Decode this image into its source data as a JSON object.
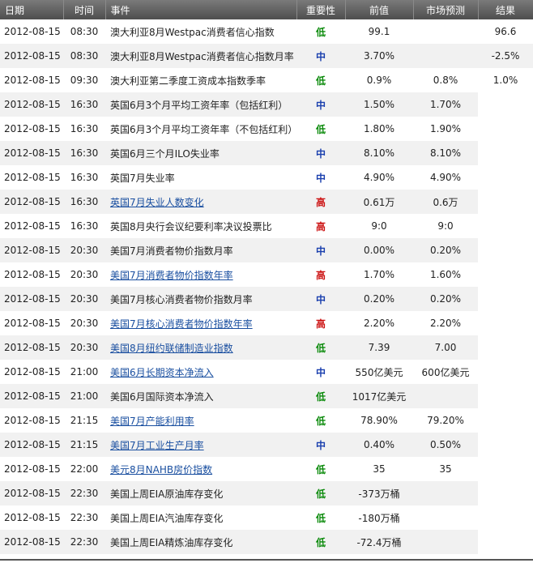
{
  "headers": {
    "date": "日期",
    "time": "时间",
    "event": "事件",
    "importance": "重要性",
    "previous": "前值",
    "forecast": "市场预测",
    "result": "结果"
  },
  "colors": {
    "low": "#0a8a0a",
    "mid": "#1a3fae",
    "high": "#cc1111",
    "link": "#1a4fa0"
  },
  "rows": [
    {
      "date": "2012-08-15",
      "time": "08:30",
      "event": "澳大利亚8月Westpac消费者信心指数",
      "link": false,
      "importance": "低",
      "level": "low",
      "previous": "99.1",
      "forecast": "",
      "result": "96.6"
    },
    {
      "date": "2012-08-15",
      "time": "08:30",
      "event": "澳大利亚8月Westpac消费者信心指数月率",
      "link": false,
      "importance": "中",
      "level": "mid",
      "previous": "3.70%",
      "forecast": "",
      "result": "-2.5%"
    },
    {
      "date": "2012-08-15",
      "time": "09:30",
      "event": "澳大利亚第二季度工资成本指数季率",
      "link": false,
      "importance": "低",
      "level": "low",
      "previous": "0.9%",
      "forecast": "0.8%",
      "result": "1.0%"
    },
    {
      "date": "2012-08-15",
      "time": "16:30",
      "event": "英国6月3个月平均工资年率（包括红利）",
      "link": false,
      "importance": "中",
      "level": "mid",
      "previous": "1.50%",
      "forecast": "1.70%",
      "result": ""
    },
    {
      "date": "2012-08-15",
      "time": "16:30",
      "event": "英国6月3个月平均工资年率（不包括红利）",
      "link": false,
      "importance": "低",
      "level": "low",
      "previous": "1.80%",
      "forecast": "1.90%",
      "result": ""
    },
    {
      "date": "2012-08-15",
      "time": "16:30",
      "event": "英国6月三个月ILO失业率",
      "link": false,
      "importance": "中",
      "level": "mid",
      "previous": "8.10%",
      "forecast": "8.10%",
      "result": ""
    },
    {
      "date": "2012-08-15",
      "time": "16:30",
      "event": "英国7月失业率",
      "link": false,
      "importance": "中",
      "level": "mid",
      "previous": "4.90%",
      "forecast": "4.90%",
      "result": ""
    },
    {
      "date": "2012-08-15",
      "time": "16:30",
      "event": "英国7月失业人数变化",
      "link": true,
      "importance": "高",
      "level": "high",
      "previous": "0.61万",
      "forecast": "0.6万",
      "result": ""
    },
    {
      "date": "2012-08-15",
      "time": "16:30",
      "event": "英国8月央行会议纪要利率决议投票比",
      "link": false,
      "importance": "高",
      "level": "high",
      "previous": "9:0",
      "forecast": "9:0",
      "result": ""
    },
    {
      "date": "2012-08-15",
      "time": "20:30",
      "event": "美国7月消费者物价指数月率",
      "link": false,
      "importance": "中",
      "level": "mid",
      "previous": "0.00%",
      "forecast": "0.20%",
      "result": ""
    },
    {
      "date": "2012-08-15",
      "time": "20:30",
      "event": "美国7月消费者物价指数年率",
      "link": true,
      "importance": "高",
      "level": "high",
      "previous": "1.70%",
      "forecast": "1.60%",
      "result": ""
    },
    {
      "date": "2012-08-15",
      "time": "20:30",
      "event": "美国7月核心消费者物价指数月率",
      "link": false,
      "importance": "中",
      "level": "mid",
      "previous": "0.20%",
      "forecast": "0.20%",
      "result": ""
    },
    {
      "date": "2012-08-15",
      "time": "20:30",
      "event": "美国7月核心消费者物价指数年率",
      "link": true,
      "importance": "高",
      "level": "high",
      "previous": "2.20%",
      "forecast": "2.20%",
      "result": ""
    },
    {
      "date": "2012-08-15",
      "time": "20:30",
      "event": "美国8月纽约联储制造业指数",
      "link": true,
      "importance": "低",
      "level": "low",
      "previous": "7.39",
      "forecast": "7.00",
      "result": ""
    },
    {
      "date": "2012-08-15",
      "time": "21:00",
      "event": "美国6月长期资本净流入",
      "link": true,
      "importance": "中",
      "level": "mid",
      "previous": "550亿美元",
      "forecast": "600亿美元",
      "result": ""
    },
    {
      "date": "2012-08-15",
      "time": "21:00",
      "event": "美国6月国际资本净流入",
      "link": false,
      "importance": "低",
      "level": "low",
      "previous": "1017亿美元",
      "forecast": "",
      "result": ""
    },
    {
      "date": "2012-08-15",
      "time": "21:15",
      "event": "美国7月产能利用率",
      "link": true,
      "importance": "低",
      "level": "low",
      "previous": "78.90%",
      "forecast": "79.20%",
      "result": ""
    },
    {
      "date": "2012-08-15",
      "time": "21:15",
      "event": "美国7月工业生产月率",
      "link": true,
      "importance": "中",
      "level": "mid",
      "previous": "0.40%",
      "forecast": "0.50%",
      "result": ""
    },
    {
      "date": "2012-08-15",
      "time": "22:00",
      "event": "美元8月NAHB房价指数",
      "link": true,
      "importance": "低",
      "level": "low",
      "previous": "35",
      "forecast": "35",
      "result": ""
    },
    {
      "date": "2012-08-15",
      "time": "22:30",
      "event": "美国上周EIA原油库存变化",
      "link": false,
      "importance": "低",
      "level": "low",
      "previous": "-373万桶",
      "forecast": "",
      "result": ""
    },
    {
      "date": "2012-08-15",
      "time": "22:30",
      "event": "美国上周EIA汽油库存变化",
      "link": false,
      "importance": "低",
      "level": "low",
      "previous": "-180万桶",
      "forecast": "",
      "result": ""
    },
    {
      "date": "2012-08-15",
      "time": "22:30",
      "event": "美国上周EIA精炼油库存变化",
      "link": false,
      "importance": "低",
      "level": "low",
      "previous": "-72.4万桶",
      "forecast": "",
      "result": ""
    }
  ]
}
